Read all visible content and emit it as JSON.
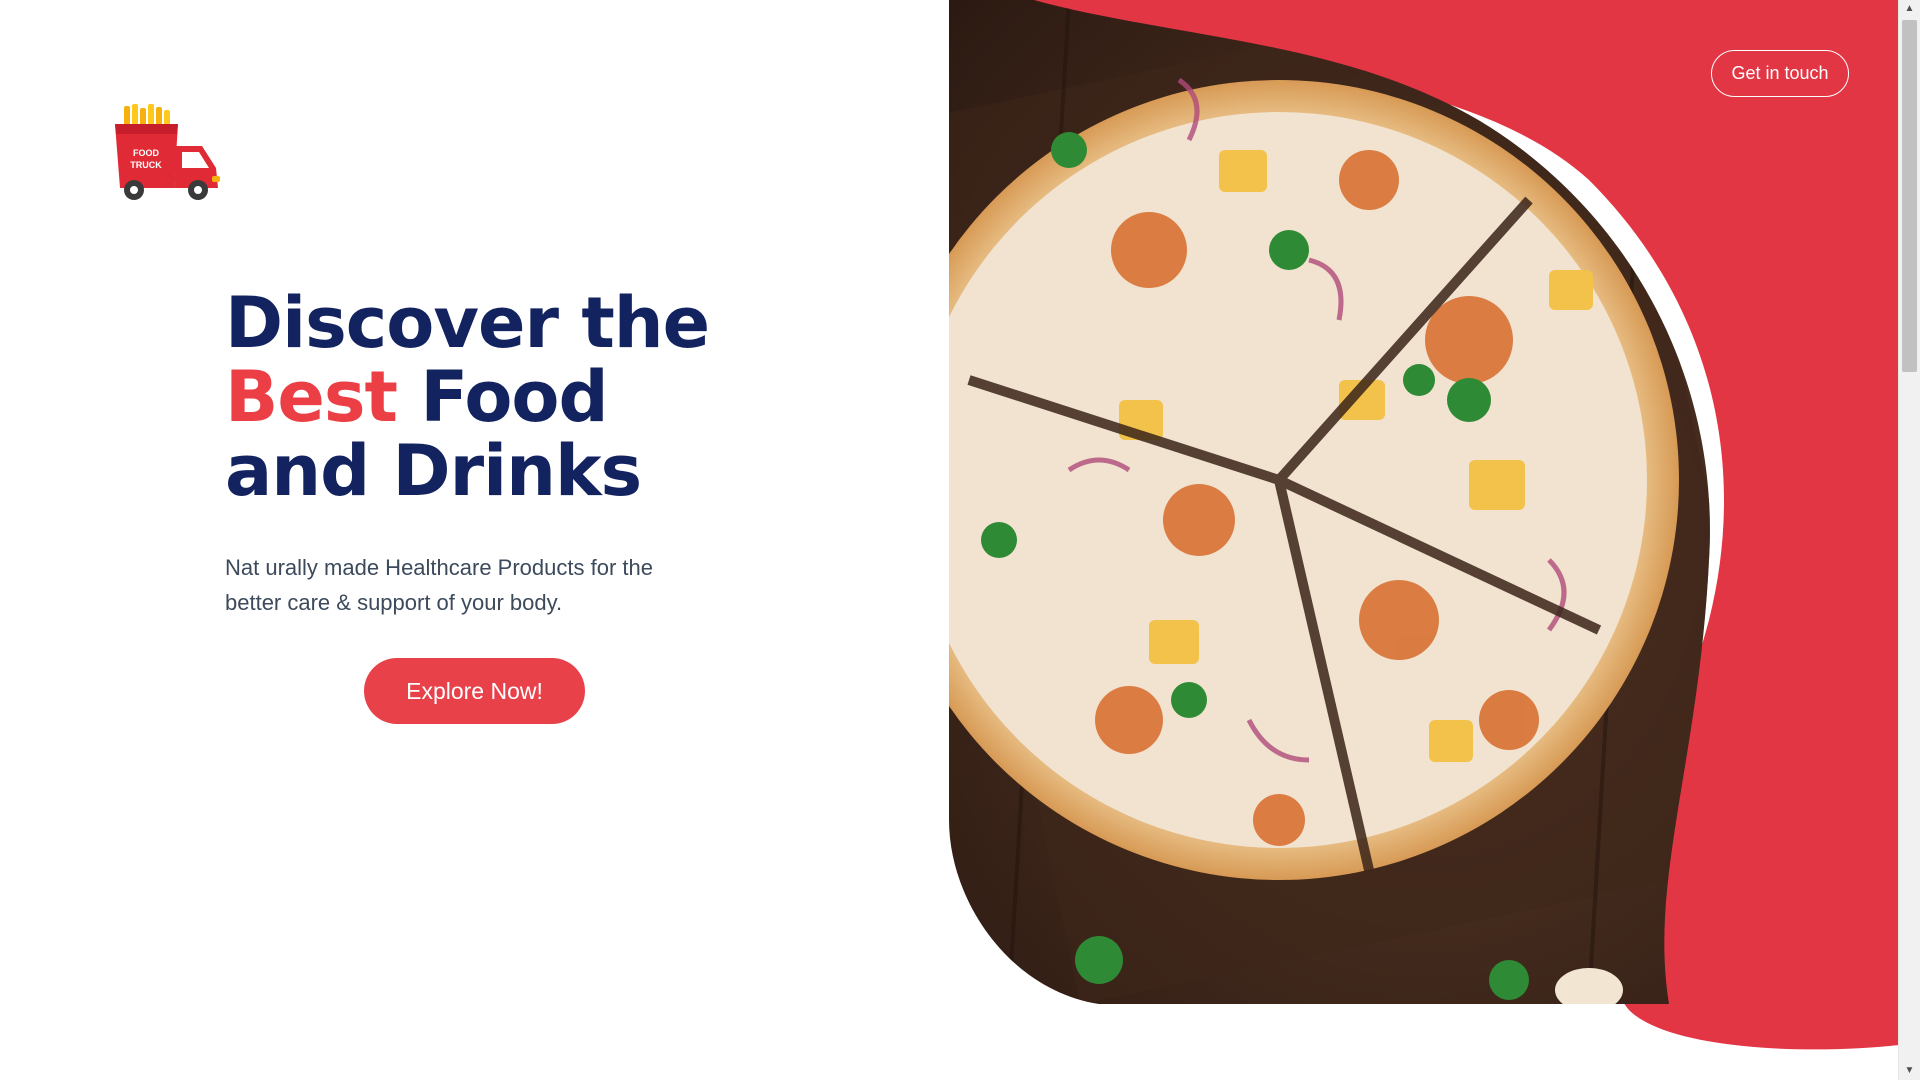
{
  "brand": {
    "logo_text_line1": "FOOD",
    "logo_text_line2": "TRUCK",
    "logo_icon": "food-truck-logo",
    "primary_color": "#ec3e45",
    "navy_color": "#13235f"
  },
  "header": {
    "contact_label": "Get in touch"
  },
  "hero": {
    "headline_line1": "Discover the",
    "headline_accent": "Best",
    "headline_line2_rest": " Food",
    "headline_line3": "and Drinks",
    "subtitle": "Nat urally made Healthcare Products for the better care & support of your body.",
    "cta_label": "Explore Now!",
    "image": "pizza-photo"
  },
  "scrollbar": {
    "up_icon": "▲",
    "down_icon": "▼"
  }
}
